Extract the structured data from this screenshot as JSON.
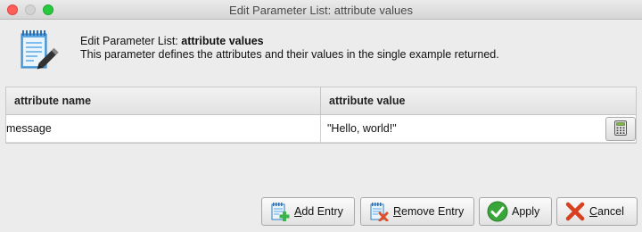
{
  "window": {
    "title": "Edit Parameter List: attribute values"
  },
  "header": {
    "icon": "notepad-pencil-icon",
    "title_prefix": "Edit Parameter List: ",
    "title_bold": "attribute values",
    "description": "This parameter defines the attributes and their values in the single example returned."
  },
  "table": {
    "columns": [
      "attribute name",
      "attribute value"
    ],
    "rows": [
      {
        "name": "message",
        "value": "\"Hello, world!\""
      }
    ],
    "value_editor_icon": "calculator-icon"
  },
  "buttons": {
    "add": {
      "mnemonic": "A",
      "rest": "dd Entry",
      "icon": "add-entry-icon"
    },
    "remove": {
      "mnemonic": "R",
      "rest": "emove Entry",
      "icon": "remove-entry-icon"
    },
    "apply": {
      "label": "Apply",
      "icon": "checkmark-icon"
    },
    "cancel": {
      "mnemonic": "C",
      "rest": "ancel",
      "icon": "x-icon"
    }
  },
  "colors": {
    "apply_green": "#3aa63a",
    "cancel_red": "#d9401f",
    "add_plus_green": "#3bb54a",
    "remove_x_red": "#e0502a"
  }
}
